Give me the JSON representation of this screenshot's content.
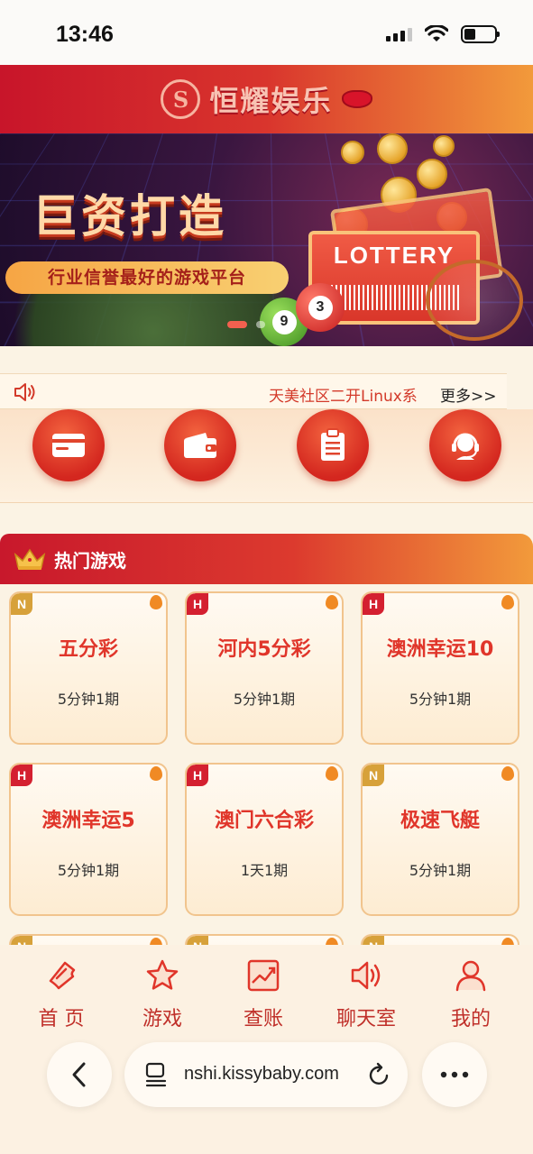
{
  "status_bar": {
    "time": "13:46"
  },
  "header": {
    "brand_name": "恒耀娱乐",
    "logo_icon": "s-coin-logo-icon",
    "accent": "#c8152a"
  },
  "banner": {
    "title": "巨资打造",
    "subtitle": "行业信誉最好的游戏平台",
    "ticket_text": "LOTTERY",
    "ball_numbers": [
      "9",
      "3"
    ],
    "slides_total": 2,
    "active_slide": 0
  },
  "notice": {
    "icon": "speaker-icon",
    "text": "天美社区二开Linux系",
    "more_label": "更多>>"
  },
  "quick_actions": [
    {
      "icon": "card-icon"
    },
    {
      "icon": "wallet-icon"
    },
    {
      "icon": "clipboard-icon"
    },
    {
      "icon": "customer-service-icon"
    }
  ],
  "hot_games": {
    "title": "热门游戏",
    "icon": "crown-icon",
    "games": [
      {
        "badge": "N",
        "name": "五分彩",
        "period": "5分钟1期"
      },
      {
        "badge": "H",
        "name": "河内5分彩",
        "period": "5分钟1期"
      },
      {
        "badge": "H",
        "name": "澳洲幸运10",
        "period": "5分钟1期"
      },
      {
        "badge": "H",
        "name": "澳洲幸运5",
        "period": "5分钟1期"
      },
      {
        "badge": "H",
        "name": "澳门六合彩",
        "period": "1天1期"
      },
      {
        "badge": "N",
        "name": "极速飞艇",
        "period": "5分钟1期"
      }
    ],
    "partial_row_badges": [
      "N",
      "N",
      "N"
    ]
  },
  "bottom_nav": [
    {
      "label": "首 页",
      "icon": "ticket-icon"
    },
    {
      "label": "游戏",
      "icon": "star-icon"
    },
    {
      "label": "查账",
      "icon": "chart-icon"
    },
    {
      "label": "聊天室",
      "icon": "speaker-icon"
    },
    {
      "label": "我的",
      "icon": "user-icon"
    }
  ],
  "browser": {
    "url": "nshi.kissybaby.com",
    "back_icon": "chevron-left-icon",
    "page_icon": "page-icon",
    "reload_icon": "reload-icon",
    "more_icon": "more-icon"
  }
}
